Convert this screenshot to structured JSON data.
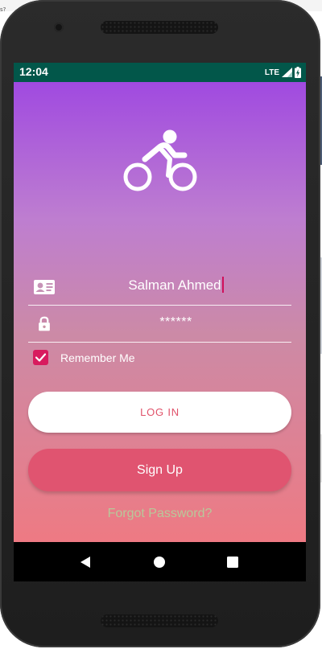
{
  "status_bar": {
    "time": "12:04",
    "network": "LTE",
    "icons": [
      "signal-icon",
      "battery-icon"
    ]
  },
  "app": {
    "logo_icon": "bicycle-icon",
    "username_field": {
      "value": "Salman Ahmed",
      "icon": "id-card-icon"
    },
    "password_field": {
      "value": "******",
      "icon": "lock-icon"
    },
    "remember_me": {
      "label": "Remember Me",
      "checked": true
    },
    "login_button": {
      "label": "LOG IN"
    },
    "signup_button": {
      "label": "Sign Up"
    },
    "forgot_link": {
      "label": "Forgot Password?"
    },
    "colors": {
      "gradient_top": "#a04ae0",
      "gradient_bottom": "#ee7a83",
      "accent": "#d81b5e",
      "status_bar": "#02574a"
    }
  },
  "nav_bar": {
    "buttons": [
      "back-icon",
      "home-icon",
      "recents-icon"
    ]
  },
  "desktop_fragment": {
    "text": "s?"
  }
}
